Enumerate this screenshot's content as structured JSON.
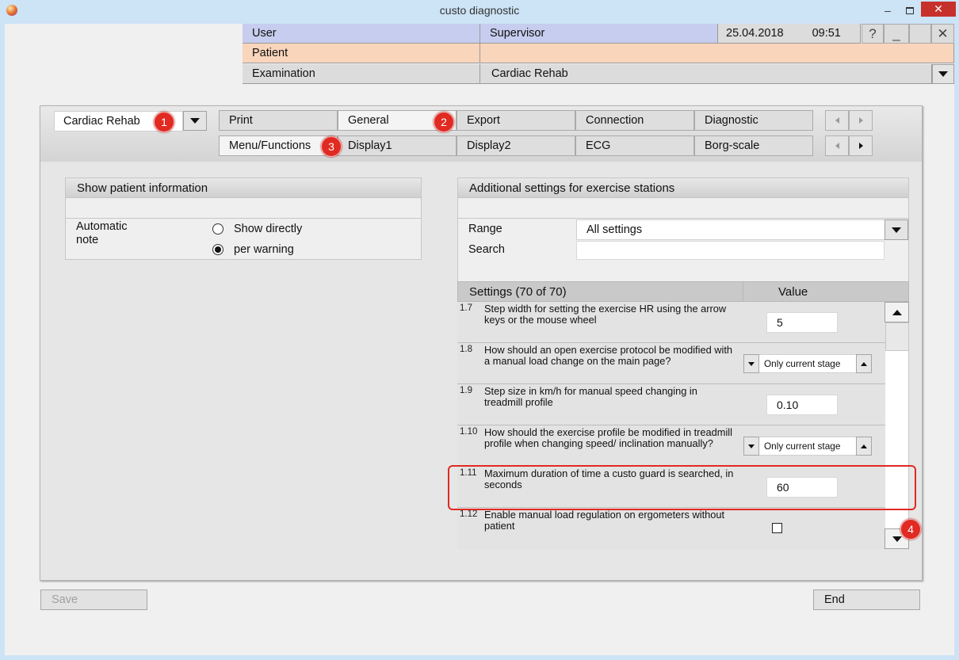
{
  "window": {
    "title": "custo diagnostic",
    "minimize": "–",
    "close": "✕"
  },
  "header": {
    "user_label": "User",
    "user_value": "Supervisor",
    "date": "25.04.2018",
    "time": "09:51",
    "help": "?",
    "minimize": "_",
    "close": "✕",
    "patient_label": "Patient",
    "patient_value": "",
    "exam_label": "Examination",
    "exam_value": "Cardiac Rehab"
  },
  "module_select": {
    "value": "Cardiac Rehab"
  },
  "tabs_row1": [
    "Print",
    "General",
    "Export",
    "Connection",
    "Diagnostic"
  ],
  "tabs_row2": [
    "Menu/Functions",
    "Display1",
    "Display2",
    "ECG",
    "Borg-scale"
  ],
  "badges": [
    "1",
    "2",
    "3",
    "4"
  ],
  "patient_info": {
    "title": "Show patient information",
    "label_line1": "Automatic",
    "label_line2": "note",
    "options": [
      "Show directly",
      "per warning"
    ],
    "selected_index": 1
  },
  "exercise": {
    "title": "Additional settings for exercise stations",
    "range_label": "Range",
    "range_value": "All settings",
    "search_label": "Search",
    "search_value": "",
    "table_head_settings": "Settings (70 of 70)",
    "table_head_value": "Value",
    "rows": [
      {
        "num": "1.7",
        "text": "Step width for setting the exercise HR using the arrow keys or the mouse wheel",
        "value": "5"
      },
      {
        "num": "1.8",
        "text": "How should an open exercise protocol be modified with a manual load change on the main page?",
        "value": "Only current stage"
      },
      {
        "num": "1.9",
        "text": "Step size in km/h for manual speed changing in treadmill profile",
        "value": "0.10"
      },
      {
        "num": "1.10",
        "text": "How should the exercise profile be modified in treadmill profile when changing speed/ inclination manually?",
        "value": "Only current stage"
      },
      {
        "num": "1.11",
        "text": "Maximum duration of time a custo guard is searched, in seconds",
        "value": "60"
      },
      {
        "num": "1.12",
        "text": "Enable manual load regulation on ergometers without patient",
        "value": false
      }
    ]
  },
  "buttons": {
    "save": "Save",
    "end": "End"
  },
  "colors": {
    "user_row": "#c6cdee",
    "patient_row": "#f9d5bc",
    "highlight": "#e02a22"
  }
}
